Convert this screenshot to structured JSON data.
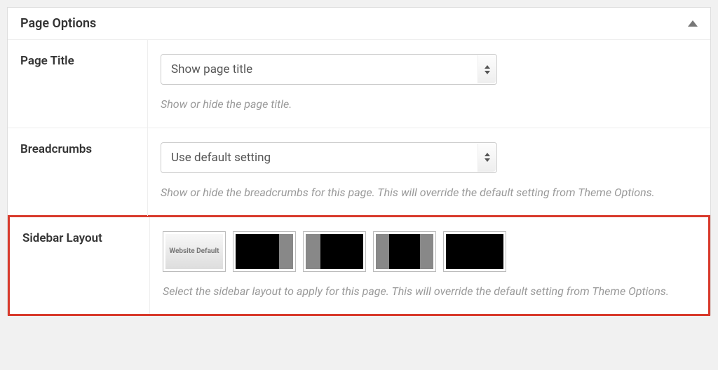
{
  "panel": {
    "title": "Page Options"
  },
  "page_title": {
    "label": "Page Title",
    "select_value": "Show page title",
    "help": "Show or hide the page title."
  },
  "breadcrumbs": {
    "label": "Breadcrumbs",
    "select_value": "Use default setting",
    "help": "Show or hide the breadcrumbs for this page. This will override the default setting from Theme Options."
  },
  "sidebar_layout": {
    "label": "Sidebar Layout",
    "default_option": "Website Default",
    "help": "Select the sidebar layout to apply for this page. This will override the default setting from Theme Options."
  }
}
